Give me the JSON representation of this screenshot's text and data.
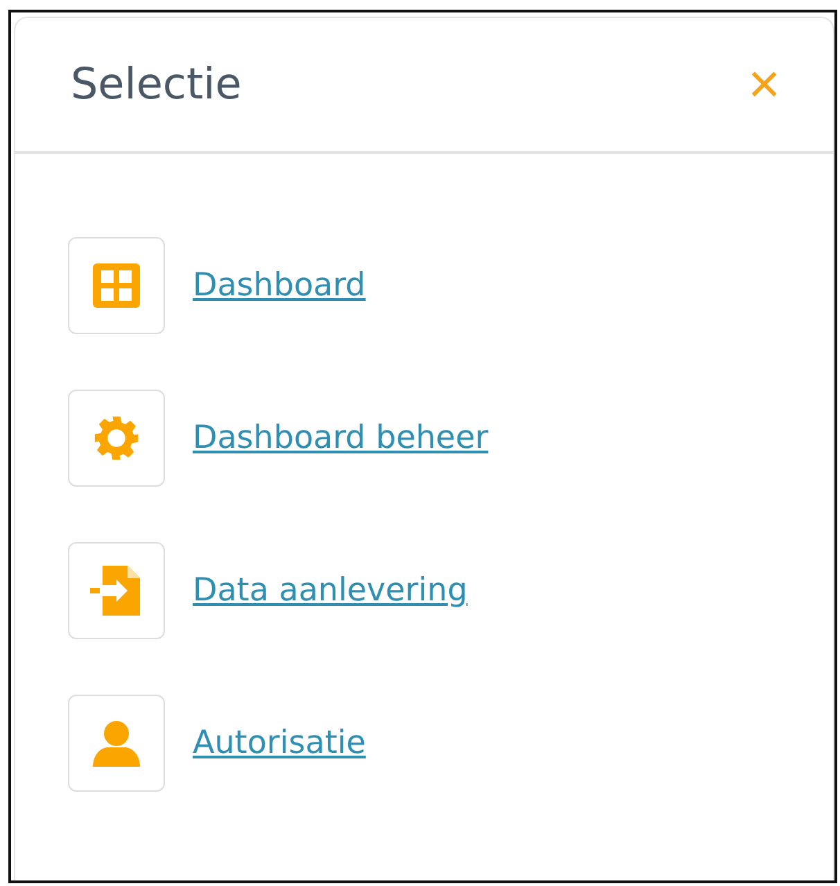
{
  "panel": {
    "title": "Selectie",
    "close": "×"
  },
  "items": [
    {
      "label": "Dashboard"
    },
    {
      "label": "Dashboard beheer"
    },
    {
      "label": "Data aanlevering"
    },
    {
      "label": "Autorisatie"
    }
  ]
}
